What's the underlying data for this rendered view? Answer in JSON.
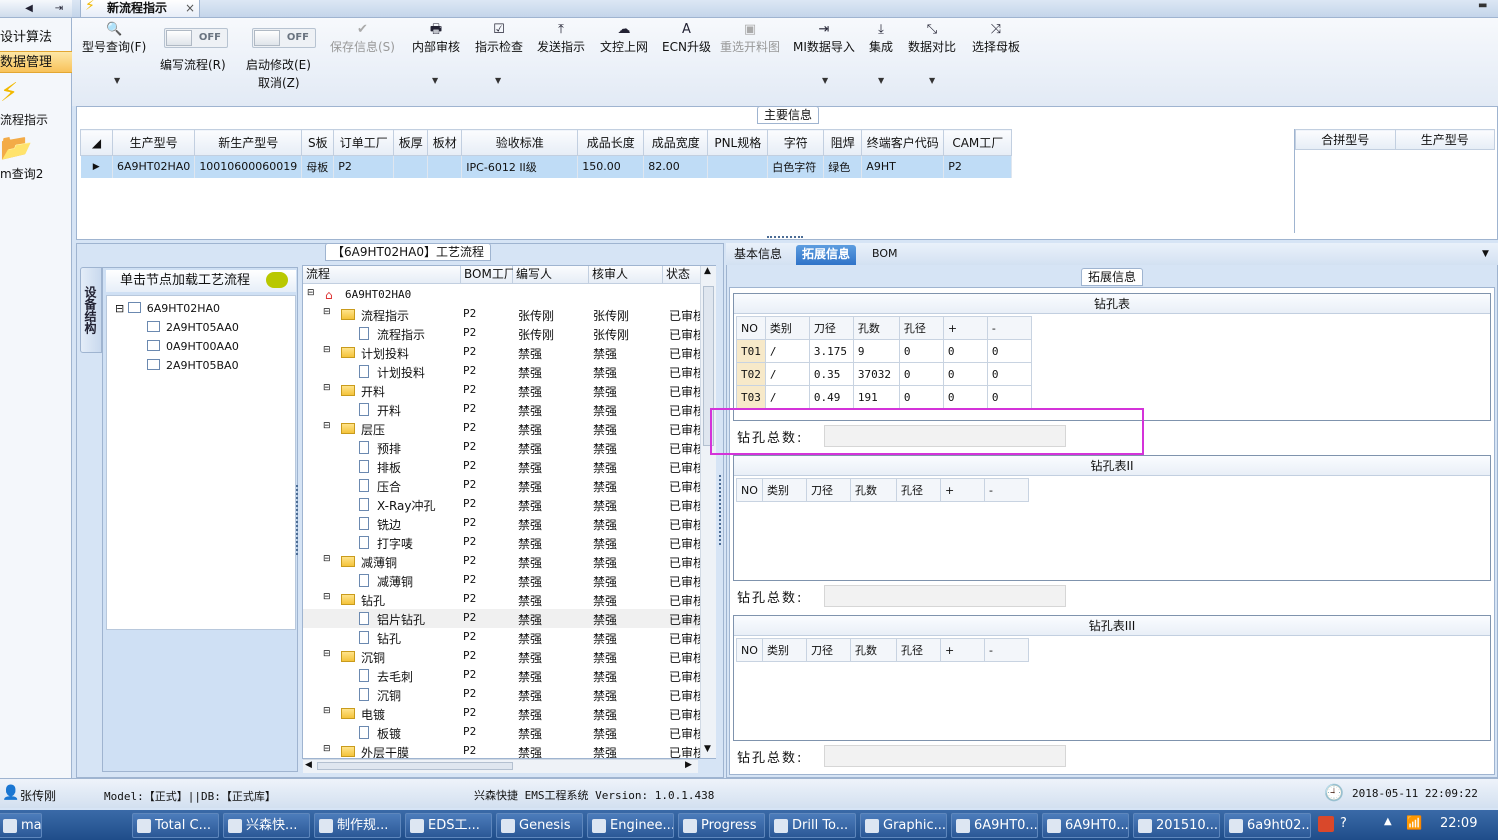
{
  "left_nav": {
    "items": [
      {
        "label": "设计算法",
        "active": false
      },
      {
        "label": "数据管理",
        "active": true
      }
    ],
    "shortcuts": [
      {
        "icon": "lightning-icon",
        "label": "流程指示"
      },
      {
        "icon": "folder-open-icon",
        "label": "m查询2"
      }
    ]
  },
  "tab": {
    "title": "新流程指示",
    "close": "×"
  },
  "ribbon": {
    "search": {
      "label": "型号查询(F)"
    },
    "toggle_write": {
      "state": "OFF",
      "label": "编写流程(R)"
    },
    "toggle_edit": {
      "state": "OFF",
      "label": "启动修改(E)",
      "sublabel": "取消(Z)"
    },
    "buttons": [
      {
        "key": "save",
        "label": "保存信息(S)",
        "icon": "✔",
        "disabled": true
      },
      {
        "key": "review",
        "label": "内部审核",
        "icon": "🖶",
        "disabled": false
      },
      {
        "key": "check",
        "label": "指示检查",
        "icon": "☑",
        "disabled": false
      },
      {
        "key": "send",
        "label": "发送指示",
        "icon": "⤒",
        "disabled": false
      },
      {
        "key": "upload",
        "label": "文控上网",
        "icon": "☁",
        "disabled": false
      },
      {
        "key": "ecn",
        "label": "ECN升级",
        "icon": "A",
        "disabled": false
      },
      {
        "key": "reopen",
        "label": "重选开料图",
        "icon": "▣",
        "disabled": true
      },
      {
        "key": "mi",
        "label": "MI数据导入",
        "icon": "⇥",
        "disabled": false
      },
      {
        "key": "integrate",
        "label": "集成",
        "icon": "⤓",
        "disabled": false
      },
      {
        "key": "compare",
        "label": "数据对比",
        "icon": "⤡",
        "disabled": false
      },
      {
        "key": "template",
        "label": "选择母板",
        "icon": "⤨",
        "disabled": false
      }
    ]
  },
  "main_info": {
    "section_title": "主要信息",
    "columns": [
      "生产型号",
      "新生产型号",
      "S板",
      "订单工厂",
      "板厚",
      "板材",
      "验收标准",
      "成品长度",
      "成品宽度",
      "PNL规格",
      "字符",
      "阻焊",
      "终端客户代码",
      "CAM工厂"
    ],
    "row": [
      "6A9HT02HA0",
      "10010600060019",
      "母板",
      "P2",
      "",
      "",
      "IPC-6012 II级",
      "150.00",
      "82.00",
      "",
      "白色字符",
      "绿色",
      "A9HT",
      "P2"
    ],
    "side_columns": [
      "合拼型号",
      "生产型号"
    ]
  },
  "structure": {
    "side_tab": "设备结构",
    "header": "单击节点加载工艺流程",
    "root": "6A9HT02HA0",
    "children": [
      "2A9HT05AA0",
      "0A9HT00AA0",
      "2A9HT05BA0"
    ]
  },
  "process": {
    "title": "【6A9HT02HA0】工艺流程",
    "columns": [
      "流程",
      "BOM工厂",
      "编写人",
      "核审人",
      "状态"
    ],
    "root": "6A9HT02HA0",
    "rows": [
      {
        "name": "流程指示",
        "level": 1,
        "factory": "P2",
        "writer": "张传刚",
        "reviewer": "张传刚",
        "status": "已审核"
      },
      {
        "name": "流程指示",
        "level": 2,
        "factory": "P2",
        "writer": "张传刚",
        "reviewer": "张传刚",
        "status": "已审核"
      },
      {
        "name": "计划投料",
        "level": 1,
        "factory": "P2",
        "writer": "禁强",
        "reviewer": "禁强",
        "status": "已审核"
      },
      {
        "name": "计划投料",
        "level": 2,
        "factory": "P2",
        "writer": "禁强",
        "reviewer": "禁强",
        "status": "已审核"
      },
      {
        "name": "开料",
        "level": 1,
        "factory": "P2",
        "writer": "禁强",
        "reviewer": "禁强",
        "status": "已审核"
      },
      {
        "name": "开料",
        "level": 2,
        "factory": "P2",
        "writer": "禁强",
        "reviewer": "禁强",
        "status": "已审核"
      },
      {
        "name": "层压",
        "level": 1,
        "factory": "P2",
        "writer": "禁强",
        "reviewer": "禁强",
        "status": "已审核"
      },
      {
        "name": "预排",
        "level": 2,
        "factory": "P2",
        "writer": "禁强",
        "reviewer": "禁强",
        "status": "已审核"
      },
      {
        "name": "排板",
        "level": 2,
        "factory": "P2",
        "writer": "禁强",
        "reviewer": "禁强",
        "status": "已审核"
      },
      {
        "name": "压合",
        "level": 2,
        "factory": "P2",
        "writer": "禁强",
        "reviewer": "禁强",
        "status": "已审核"
      },
      {
        "name": "X-Ray冲孔",
        "level": 2,
        "factory": "P2",
        "writer": "禁强",
        "reviewer": "禁强",
        "status": "已审核"
      },
      {
        "name": "铣边",
        "level": 2,
        "factory": "P2",
        "writer": "禁强",
        "reviewer": "禁强",
        "status": "已审核"
      },
      {
        "name": "打字唛",
        "level": 2,
        "factory": "P2",
        "writer": "禁强",
        "reviewer": "禁强",
        "status": "已审核"
      },
      {
        "name": "减薄铜",
        "level": 1,
        "factory": "P2",
        "writer": "禁强",
        "reviewer": "禁强",
        "status": "已审核"
      },
      {
        "name": "减薄铜",
        "level": 2,
        "factory": "P2",
        "writer": "禁强",
        "reviewer": "禁强",
        "status": "已审核"
      },
      {
        "name": "钻孔",
        "level": 1,
        "factory": "P2",
        "writer": "禁强",
        "reviewer": "禁强",
        "status": "已审核"
      },
      {
        "name": "铝片钻孔",
        "level": 2,
        "factory": "P2",
        "writer": "禁强",
        "reviewer": "禁强",
        "status": "已审核"
      },
      {
        "name": "钻孔",
        "level": 2,
        "factory": "P2",
        "writer": "禁强",
        "reviewer": "禁强",
        "status": "已审核"
      },
      {
        "name": "沉铜",
        "level": 1,
        "factory": "P2",
        "writer": "禁强",
        "reviewer": "禁强",
        "status": "已审核"
      },
      {
        "name": "去毛刺",
        "level": 2,
        "factory": "P2",
        "writer": "禁强",
        "reviewer": "禁强",
        "status": "已审核"
      },
      {
        "name": "沉铜",
        "level": 2,
        "factory": "P2",
        "writer": "禁强",
        "reviewer": "禁强",
        "status": "已审核"
      },
      {
        "name": "电镀",
        "level": 1,
        "factory": "P2",
        "writer": "禁强",
        "reviewer": "禁强",
        "status": "已审核"
      },
      {
        "name": "板镀",
        "level": 2,
        "factory": "P2",
        "writer": "禁强",
        "reviewer": "禁强",
        "status": "已审核"
      },
      {
        "name": "外层干膜",
        "level": 1,
        "factory": "P2",
        "writer": "禁强",
        "reviewer": "禁强",
        "status": "已审核"
      }
    ]
  },
  "right": {
    "tabs": [
      "基本信息",
      "拓展信息",
      "BOM"
    ],
    "active_tab": "拓展信息",
    "section_title": "拓展信息",
    "drill_columns": [
      "NO",
      "类别",
      "刀径",
      "孔数",
      "孔径",
      "+",
      "-"
    ],
    "tables": [
      {
        "title": "钻孔表",
        "rows": [
          [
            "T01",
            "/",
            "3.175",
            "9",
            "0",
            "0",
            "0"
          ],
          [
            "T02",
            "/",
            "0.35",
            "37032",
            "0",
            "0",
            "0"
          ],
          [
            "T03",
            "/",
            "0.49",
            "191",
            "0",
            "0",
            "0"
          ]
        ]
      },
      {
        "title": "钻孔表II",
        "rows": []
      },
      {
        "title": "钻孔表III",
        "rows": []
      }
    ],
    "total_label": "钻孔总数:"
  },
  "status": {
    "user": "张传刚",
    "model": "Model:【正式】||DB:【正式库】",
    "system": "兴森快捷 EMS工程系统 Version: 1.0.1.438",
    "datetime": "2018-05-11 22:09:22"
  },
  "taskbar": {
    "items": [
      "mail",
      "Total C...",
      "兴森快...",
      "制作规...",
      "EDS工...",
      "Genesis",
      "Enginee...",
      "Progress",
      "Drill To...",
      "Graphic...",
      "6A9HT0...",
      "6A9HT0...",
      "201510...",
      "6a9ht02..."
    ],
    "clock": "22:09"
  },
  "colors": {
    "accent": "#2f73c8",
    "highlight_box": "#d433d9",
    "row_select": "#bfdcf6",
    "nav_active": "#f8c25a"
  }
}
